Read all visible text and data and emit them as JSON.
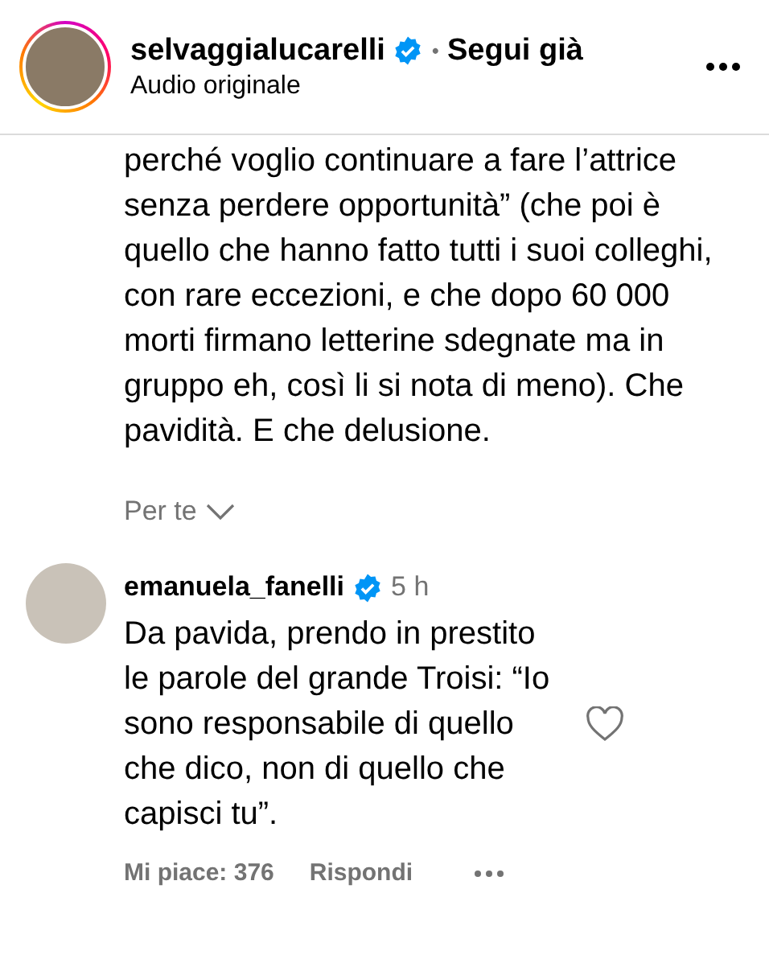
{
  "header": {
    "username": "selvaggialucarelli",
    "verified": true,
    "separator": "•",
    "follow_label": "Segui già",
    "subtitle": "Audio originale"
  },
  "caption": {
    "text": "perché voglio continuare a fare l’attrice senza perdere opportunità” (che poi è quello che hanno fatto tutti i suoi colleghi, con rare eccezioni, e che dopo 60 000 morti firmano letterine sdegnate ma in gruppo eh, così li si nota di meno). Che pavidità. E che delusione."
  },
  "sort": {
    "label": "Per te"
  },
  "comments": [
    {
      "username": "emanuela_fanelli",
      "verified": true,
      "time": "5 h",
      "text": "Da pavida, prendo in prestito le parole del grande Troisi: “Io sono responsabile di quello che dico, non di quello che capisci tu”.",
      "liked": false,
      "likes": "Mi piace: 376",
      "reply_label": "Rispondi"
    }
  ]
}
